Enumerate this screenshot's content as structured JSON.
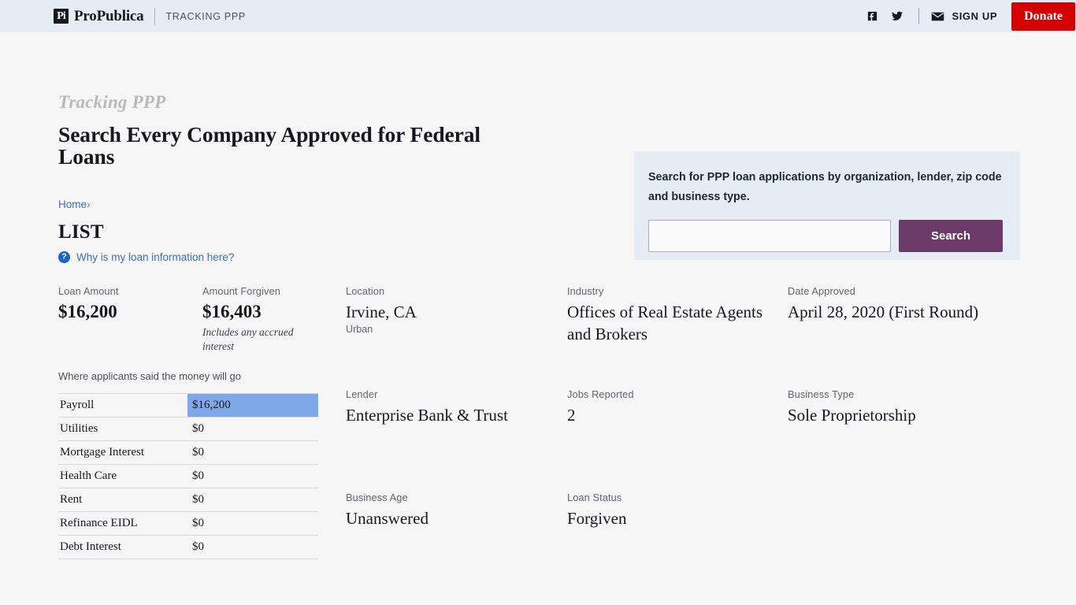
{
  "header": {
    "logo_mark": "propublica-logo-icon",
    "logo_word": "ProPublica",
    "section": "TRACKING PPP",
    "facebook": "facebook-icon",
    "twitter": "twitter-icon",
    "mail": "mail-icon",
    "signup_label": "SIGN UP",
    "donate_label": "Donate",
    "donate_color": "#d40000",
    "bar_color": "#e6ecf4"
  },
  "hero": {
    "kicker": "Tracking PPP",
    "title": "Search Every Company Approved for Federal Loans"
  },
  "search": {
    "prompt": "Search for PPP loan applications by organization, lender, zip code and business type.",
    "value": "",
    "placeholder": "",
    "button_label": "Search",
    "button_color": "#6b3a69"
  },
  "breadcrumb": {
    "home": "Home",
    "separator": "›"
  },
  "page": {
    "title": "LIST",
    "help_icon": "question-mark-icon",
    "help_link": "Why is my loan information here?"
  },
  "fields": {
    "loan_amount": {
      "label": "Loan Amount",
      "value": "$16,200"
    },
    "amount_forgiven": {
      "label": "Amount Forgiven",
      "value": "$16,403",
      "note": "Includes any accrued interest"
    },
    "location": {
      "label": "Location",
      "value": "Irvine, CA",
      "sub": "Urban"
    },
    "industry": {
      "label": "Industry",
      "value": "Offices of Real Estate Agents and Brokers"
    },
    "date_approved": {
      "label": "Date Approved",
      "value": "April 28, 2020 (First Round)"
    },
    "lender": {
      "label": "Lender",
      "value": "Enterprise Bank & Trust"
    },
    "jobs_reported": {
      "label": "Jobs Reported",
      "value": "2"
    },
    "business_type": {
      "label": "Business Type",
      "value": "Sole Proprietorship"
    },
    "business_age": {
      "label": "Business Age",
      "value": "Unanswered"
    },
    "loan_status": {
      "label": "Loan Status",
      "value": "Forgiven"
    }
  },
  "allocation": {
    "caption": "Where applicants said the money will go",
    "bar_color": "#7fa8e8",
    "rows": [
      {
        "category": "Payroll",
        "amount": "$16,200",
        "fill": 100
      },
      {
        "category": "Utilities",
        "amount": "$0",
        "fill": 0
      },
      {
        "category": "Mortgage Interest",
        "amount": "$0",
        "fill": 0
      },
      {
        "category": "Health Care",
        "amount": "$0",
        "fill": 0
      },
      {
        "category": "Rent",
        "amount": "$0",
        "fill": 0
      },
      {
        "category": "Refinance EIDL",
        "amount": "$0",
        "fill": 0
      },
      {
        "category": "Debt Interest",
        "amount": "$0",
        "fill": 0
      }
    ]
  }
}
